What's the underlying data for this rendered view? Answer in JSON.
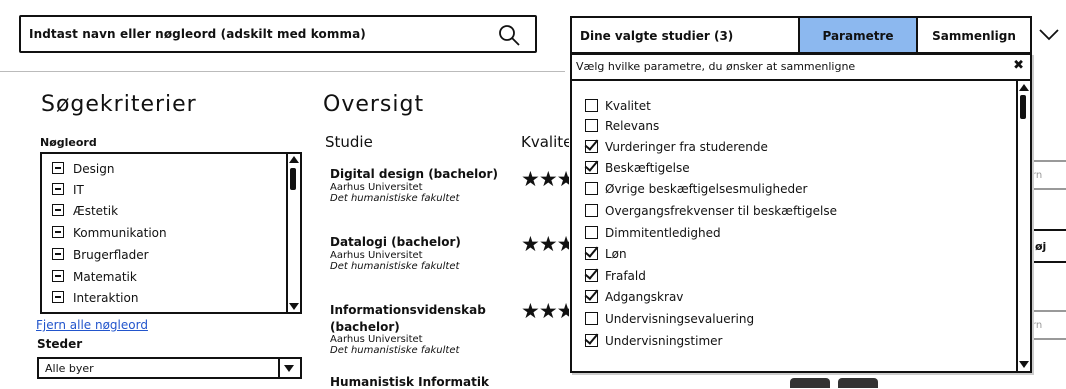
{
  "search": {
    "placeholder": "Indtast navn eller nøgleord (adskilt med komma)"
  },
  "header": {
    "selected_studies": "Dine valgte studier (3)",
    "params_button": "Parametre",
    "compare_button": "Sammenlign"
  },
  "left": {
    "title": "Søgekriterier",
    "keywords_label": "Nøgleord",
    "keywords": [
      "Design",
      "IT",
      "Æstetik",
      "Kommunikation",
      "Brugerflader",
      "Matematik",
      "Interaktion"
    ],
    "clear_keywords": "Fjern alle nøgleord",
    "places_label": "Steder",
    "city_value": "Alle byer"
  },
  "overview": {
    "title": "Oversigt",
    "col_study": "Studie",
    "col_quality": "Kvalitet",
    "studies": [
      {
        "title": "Digital design (bachelor)",
        "university": "Aarhus Universitet",
        "faculty": "Det humanistiske fakultet",
        "stars": "★★★"
      },
      {
        "title": "Datalogi (bachelor)",
        "university": "Aarhus Universitet",
        "faculty": "Det humanistiske fakultet",
        "stars": "★★★"
      },
      {
        "title": "Informationsvidenskab",
        "title2": "(bachelor)",
        "university": "Aarhus Universitet",
        "faculty": "Det humanistiske fakultet",
        "stars": "★★★"
      }
    ],
    "partial_row_title": "Humanistisk Informatik",
    "side_buttons": [
      "rn",
      "øj",
      "rn"
    ]
  },
  "params_dropdown": {
    "header": "Vælg hvilke parametre, du ønsker at sammenligne",
    "close": "✖",
    "items": [
      {
        "label": "Kvalitet",
        "checked": false
      },
      {
        "label": "Relevans",
        "checked": false
      },
      {
        "label": "Vurderinger fra studerende",
        "checked": true
      },
      {
        "label": "Beskæftigelse",
        "checked": true
      },
      {
        "label": "Øvrige beskæftigelsesmuligheder",
        "checked": false
      },
      {
        "label": "Overgangsfrekvenser til beskæftigelse",
        "checked": false
      },
      {
        "label": "Dimmitentledighed",
        "checked": false
      },
      {
        "label": "Løn",
        "checked": true
      },
      {
        "label": "Frafald",
        "checked": true
      },
      {
        "label": "Adgangskrav",
        "checked": true
      },
      {
        "label": "Undervisningsevaluering",
        "checked": false
      },
      {
        "label": "Undervisningstimer",
        "checked": true
      }
    ]
  },
  "icons": [
    "search-icon",
    "chevron-down-icon",
    "close-icon",
    "minus-icon",
    "checkbox-icon",
    "star-icon"
  ],
  "colors": {
    "accent_button": "#8cb8ef",
    "link": "#2255cc"
  }
}
